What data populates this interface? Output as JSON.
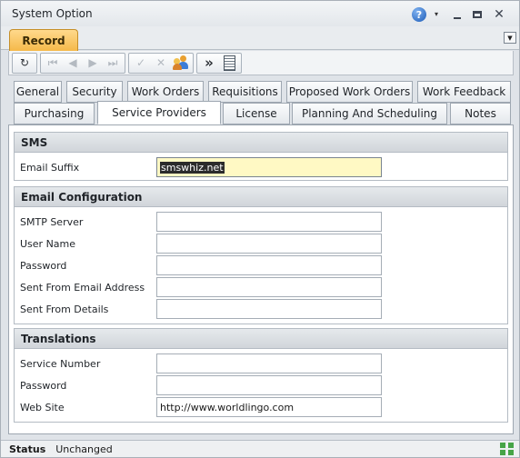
{
  "window": {
    "title": "System Option",
    "help_icon": "question-circle-icon",
    "help_glyph": "?",
    "dropdown_glyph": "▾",
    "minimize_icon": "minimize-icon",
    "restore_icon": "restore-icon",
    "close_icon": "close-icon",
    "close_glyph": "✕"
  },
  "record_tab": {
    "label": "Record",
    "accent": "#f5b94a"
  },
  "strip_menu_glyph": "▼",
  "toolbar": {
    "refresh_glyph": "↻",
    "first_glyph": "⏮",
    "prev_glyph": "◀",
    "next_glyph": "▶",
    "last_glyph": "⏭",
    "check_glyph": "✓",
    "cancel_glyph": "✕",
    "more_glyph": "»"
  },
  "tabs_row1": [
    "General",
    "Security",
    "Work Orders",
    "Requisitions",
    "Proposed Work Orders",
    "Work Feedback"
  ],
  "tabs_row2": [
    "Purchasing",
    "Service Providers",
    "License",
    "Planning And Scheduling",
    "Notes"
  ],
  "active_tab": "Service Providers",
  "sms": {
    "heading": "SMS",
    "email_suffix_label": "Email Suffix",
    "email_suffix_value": "smswhiz.net"
  },
  "email_config": {
    "heading": "Email Configuration",
    "smtp_label": "SMTP Server",
    "smtp_value": "",
    "username_label": "User Name",
    "username_value": "",
    "password_label": "Password",
    "password_value": "",
    "sent_from_address_label": "Sent From Email Address",
    "sent_from_address_value": "",
    "sent_from_details_label": "Sent From Details",
    "sent_from_details_value": ""
  },
  "translations": {
    "heading": "Translations",
    "service_number_label": "Service Number",
    "service_number_value": "",
    "password_label": "Password",
    "password_value": "",
    "website_label": "Web Site",
    "website_value": "http://www.worldlingo.com"
  },
  "status": {
    "label": "Status",
    "value": "Unchanged"
  }
}
